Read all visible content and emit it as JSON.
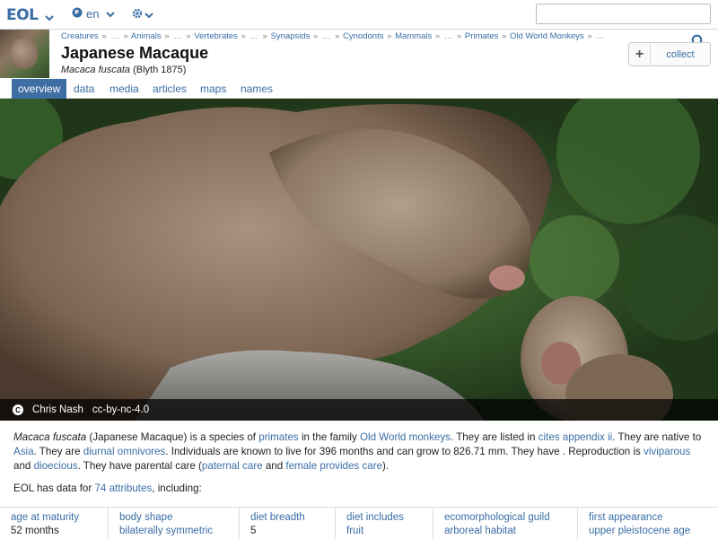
{
  "topbar": {
    "logo": "EOL",
    "language": "en",
    "search_placeholder": ""
  },
  "header": {
    "breadcrumbs": [
      {
        "label": "Creatures",
        "link": true
      },
      {
        "label": "»",
        "link": false
      },
      {
        "label": "…",
        "link": false
      },
      {
        "label": "»",
        "link": false
      },
      {
        "label": "Animals",
        "link": true
      },
      {
        "label": "»",
        "link": false
      },
      {
        "label": "…",
        "link": false
      },
      {
        "label": "»",
        "link": false
      },
      {
        "label": "Vertebrates",
        "link": true
      },
      {
        "label": "»",
        "link": false
      },
      {
        "label": "…",
        "link": false
      },
      {
        "label": "»",
        "link": false
      },
      {
        "label": "Synapsids",
        "link": true
      },
      {
        "label": "»",
        "link": false
      },
      {
        "label": "…",
        "link": false
      },
      {
        "label": "»",
        "link": false
      },
      {
        "label": "Cynodonts",
        "link": true
      },
      {
        "label": "»",
        "link": false
      },
      {
        "label": "Mammals",
        "link": true
      },
      {
        "label": "»",
        "link": false
      },
      {
        "label": "…",
        "link": false
      },
      {
        "label": "»",
        "link": false
      },
      {
        "label": "Primates",
        "link": true
      },
      {
        "label": "»",
        "link": false
      },
      {
        "label": "Old World Monkeys",
        "link": true
      },
      {
        "label": "»",
        "link": false
      },
      {
        "label": "…",
        "link": false
      }
    ],
    "title": "Japanese Macaque",
    "scientific_name": "Macaca fuscata",
    "authority": "(Blyth 1875)",
    "collect_plus": "+",
    "collect_label": "collect"
  },
  "tabs": [
    {
      "label": "overview",
      "active": true
    },
    {
      "label": "data",
      "active": false
    },
    {
      "label": "media",
      "active": false
    },
    {
      "label": "articles",
      "active": false
    },
    {
      "label": "maps",
      "active": false
    },
    {
      "label": "names",
      "active": false
    }
  ],
  "image": {
    "cc_symbol": "C",
    "photographer": "Chris Nash",
    "license": "cc-by-nc-4.0"
  },
  "description": {
    "sci": "Macaca fuscata",
    "t1": " (Japanese Macaque) is a species of ",
    "l1": "primates",
    "t2": " in the family ",
    "l2": "Old World monkeys",
    "t3": ". They are listed in ",
    "l3": "cites appendix ii",
    "t4": ". They are native to ",
    "l4": "Asia",
    "t5": ". They are ",
    "l5": "diurnal omnivores",
    "t6": ". Individuals are known to live for 396 months and can grow to 826.71 mm. They have . Reproduction is ",
    "l6": "viviparous",
    "t7": " and ",
    "l7": "dioecious",
    "t8": ". They have parental care (",
    "l8": "paternal care",
    "t9": " and ",
    "l9": "female provides care",
    "t10": ")."
  },
  "data_summary": {
    "prefix": "EOL has data for ",
    "count_link": "74 attributes",
    "suffix": ", including:"
  },
  "attributes": [
    {
      "name": "age at maturity",
      "value": "52 months",
      "value_link": false
    },
    {
      "name": "body shape",
      "value": "bilaterally symmetric",
      "value_link": true
    },
    {
      "name": "diet breadth",
      "value": "5",
      "value_link": false
    },
    {
      "name": "diet includes",
      "value": "fruit",
      "value_link": true
    },
    {
      "name": "ecomorphological guild",
      "value": "arboreal habitat",
      "value_link": true
    },
    {
      "name": "first appearance",
      "value": "upper pleistocene age",
      "value_link": true
    }
  ],
  "colors": {
    "link": "#3a6ea5",
    "active_tab": "#3e6ea3",
    "foliage": "#2e4b27",
    "fur": "#8a7462",
    "rock": "#8f8f8c"
  }
}
